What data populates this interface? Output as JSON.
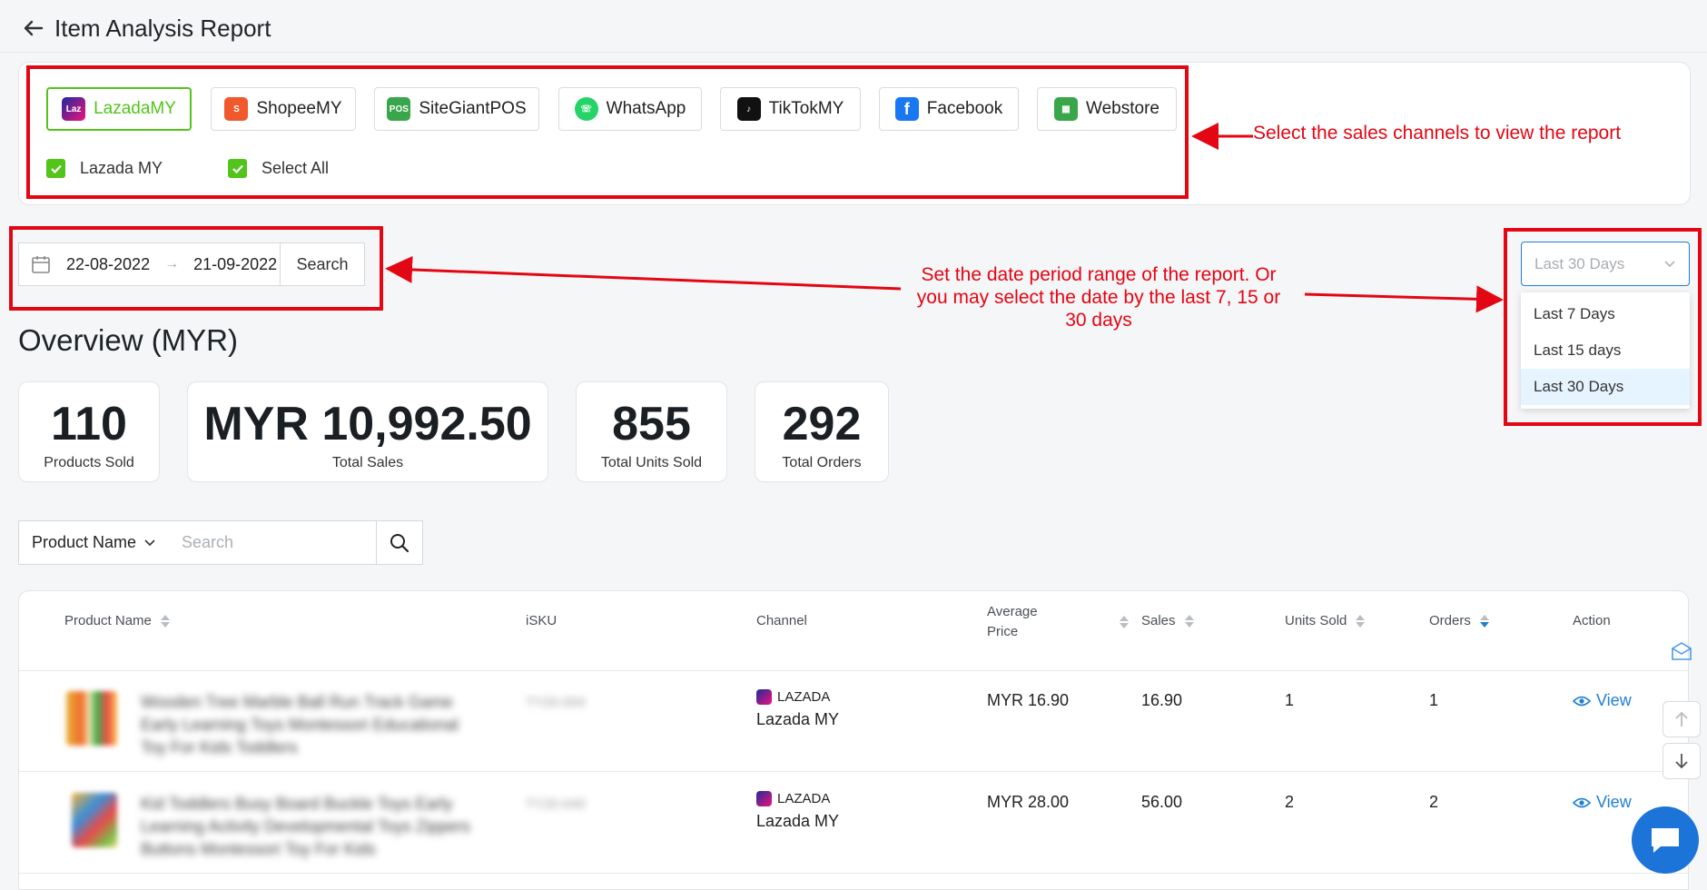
{
  "header": {
    "title": "Item Analysis Report"
  },
  "channels": [
    {
      "label": "LazadaMY",
      "active": true
    },
    {
      "label": "ShopeeMY",
      "active": false
    },
    {
      "label": "SiteGiantPOS",
      "active": false
    },
    {
      "label": "WhatsApp",
      "active": false
    },
    {
      "label": "TikTokMY",
      "active": false
    },
    {
      "label": "Facebook",
      "active": false
    },
    {
      "label": "Webstore",
      "active": false
    }
  ],
  "channel_checks": [
    {
      "label": "Lazada MY",
      "checked": true
    },
    {
      "label": "Select All",
      "checked": true
    }
  ],
  "annotations": {
    "channels": "Select the sales channels to view the report",
    "date": "Set the date period range of the report. Or you may select the date by the last 7, 15 or 30 days"
  },
  "date_range": {
    "start": "22-08-2022",
    "end": "21-09-2022",
    "search_label": "Search"
  },
  "period": {
    "selected": "Last 30 Days",
    "options": [
      "Last 7 Days",
      "Last 15 days",
      "Last 30 Days"
    ]
  },
  "overview": {
    "title": "Overview (MYR)",
    "stats": [
      {
        "value": "110",
        "label": "Products Sold"
      },
      {
        "value": "MYR 10,992.50",
        "label": "Total Sales"
      },
      {
        "value": "855",
        "label": "Total Units Sold"
      },
      {
        "value": "292",
        "label": "Total Orders"
      }
    ]
  },
  "filter": {
    "field": "Product Name",
    "placeholder": "Search"
  },
  "table": {
    "columns": {
      "product_name": "Product Name",
      "isku": "iSKU",
      "channel": "Channel",
      "avg_price_1": "Average",
      "avg_price_2": "Price",
      "sales": "Sales",
      "units_sold": "Units Sold",
      "orders": "Orders",
      "action": "Action"
    },
    "rows": [
      {
        "product_lines": [
          "Wooden Tree Marble Ball Run Track Game",
          "Early Learning Toys Montessori Educational",
          "Toy For Kids Toddlers"
        ],
        "isku": "TY20-004",
        "channel_code": "LAZADA",
        "channel_name": "Lazada MY",
        "avg_price": "MYR 16.90",
        "sales": "16.90",
        "units": "1",
        "orders": "1",
        "action": "View"
      },
      {
        "product_lines": [
          "Kid Toddlers Busy Board Buckle Toys Early",
          "Learning Activity Developmental Toys Zippers",
          "Buttons Montessori Toy For Kids"
        ],
        "isku": "TY20-040",
        "channel_code": "LAZADA",
        "channel_name": "Lazada MY",
        "avg_price": "MYR 28.00",
        "sales": "56.00",
        "units": "2",
        "orders": "2",
        "action": "View"
      }
    ]
  },
  "colors": {
    "accent_green": "#52c41a",
    "annotation_red": "#e30613",
    "link_blue": "#1e7fd4"
  }
}
